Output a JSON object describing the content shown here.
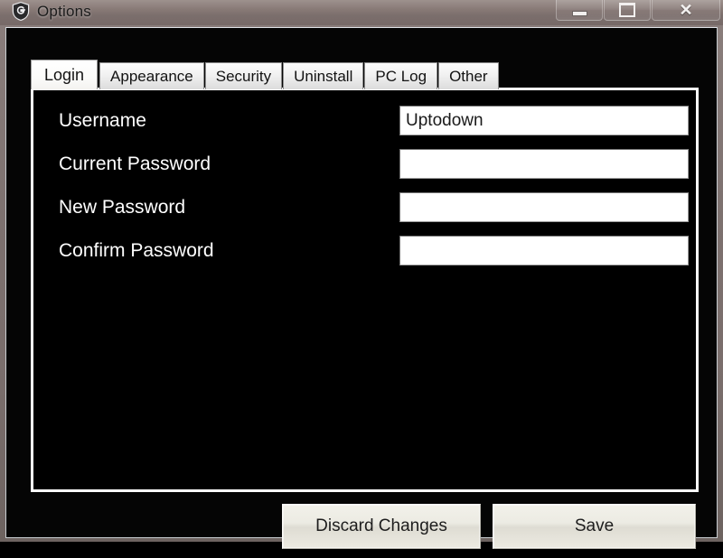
{
  "window": {
    "title": "Options",
    "icon": "shield-icon",
    "caption_buttons": [
      {
        "name": "minimize",
        "glyph": "–"
      },
      {
        "name": "maximize",
        "glyph": "□"
      },
      {
        "name": "close",
        "glyph": "✕"
      }
    ]
  },
  "tabs": [
    {
      "label": "Login",
      "active": true
    },
    {
      "label": "Appearance",
      "active": false
    },
    {
      "label": "Security",
      "active": false
    },
    {
      "label": "Uninstall",
      "active": false
    },
    {
      "label": "PC Log",
      "active": false
    },
    {
      "label": "Other",
      "active": false
    }
  ],
  "form": {
    "fields": [
      {
        "label": "Username",
        "value": "Uptodown",
        "placeholder": "",
        "type": "text",
        "name": "username"
      },
      {
        "label": "Current Password",
        "value": "",
        "placeholder": "",
        "type": "password",
        "name": "current-password"
      },
      {
        "label": "New Password",
        "value": "",
        "placeholder": "",
        "type": "password",
        "name": "new-password"
      },
      {
        "label": "Confirm Password",
        "value": "",
        "placeholder": "",
        "type": "password",
        "name": "confirm-password"
      }
    ]
  },
  "buttons": {
    "discard_label": "Discard Changes",
    "save_label": "Save"
  },
  "colors": {
    "titlebar": "#7b6e6c",
    "client_background": "#050505",
    "panel_border": "#ffffff",
    "label_text": "#ffffff",
    "input_background": "#ffffff",
    "tab_active_background": "#ffffff",
    "button_face": "#ecebe3"
  }
}
